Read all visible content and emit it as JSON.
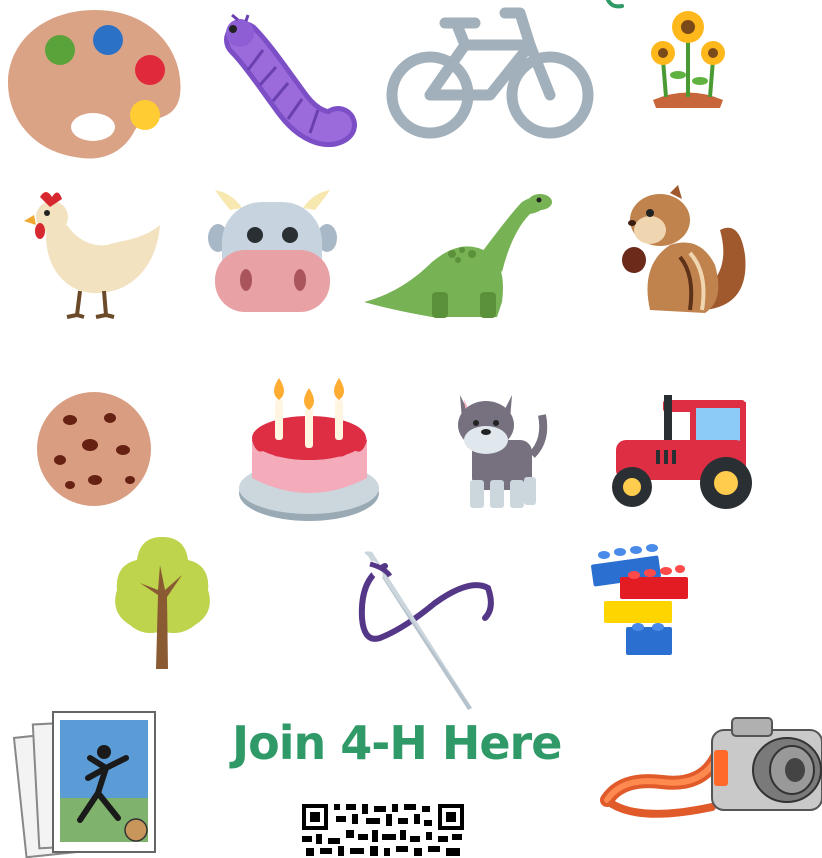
{
  "icons": [
    {
      "name": "paint-palette-icon"
    },
    {
      "name": "caterpillar-icon"
    },
    {
      "name": "bicycle-icon"
    },
    {
      "name": "sunflowers-icon"
    },
    {
      "name": "chicken-icon"
    },
    {
      "name": "cow-face-icon"
    },
    {
      "name": "dinosaur-icon"
    },
    {
      "name": "chipmunk-icon"
    },
    {
      "name": "cookie-icon"
    },
    {
      "name": "birthday-cake-icon"
    },
    {
      "name": "schnauzer-dog-icon"
    },
    {
      "name": "tractor-icon"
    },
    {
      "name": "tree-icon"
    },
    {
      "name": "needle-and-thread-icon"
    },
    {
      "name": "building-blocks-icon"
    },
    {
      "name": "baseball-cards-icon"
    },
    {
      "name": "camera-icon"
    },
    {
      "name": "qr-code-icon"
    }
  ],
  "cta": {
    "text": "Join 4-H Here",
    "color": "#2f9a68"
  },
  "colors": {
    "background": "#ffffff",
    "accent_green": "#2f9a68"
  }
}
